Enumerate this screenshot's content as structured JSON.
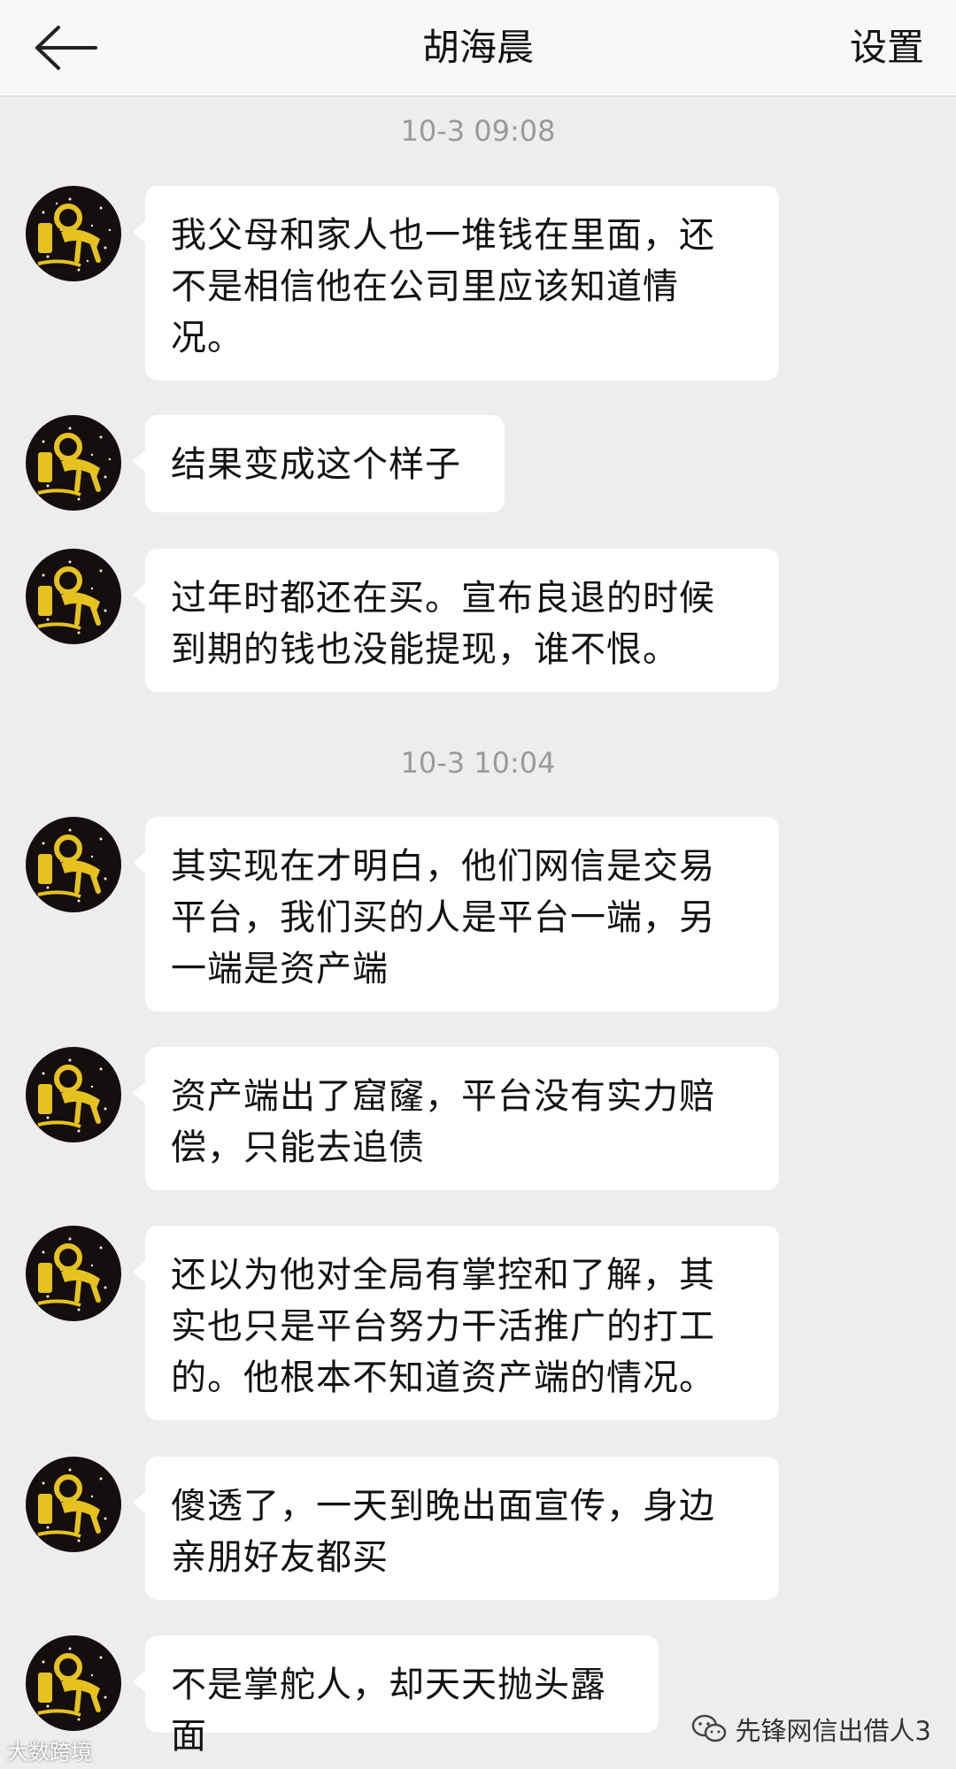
{
  "header": {
    "title": "胡海晨",
    "settings_label": "设置",
    "back_icon": "back-arrow-icon"
  },
  "timestamps": [
    "10-3 09:08",
    "10-3 10:04"
  ],
  "messages": [
    {
      "text": "我父母和家人也一堆钱在里面，还\n不是相信他在公司里应该知道情\n况。"
    },
    {
      "text": "结果变成这个样子"
    },
    {
      "text": "过年时都还在买。宣布良退的时候\n到期的钱也没能提现，谁不恨。"
    },
    {
      "text": "其实现在才明白，他们网信是交易\n平台，我们买的人是平台一端，另\n一端是资产端"
    },
    {
      "text": "资产端出了窟窿，平台没有实力赔\n偿，只能去追债"
    },
    {
      "text": "还以为他对全局有掌控和了解，其\n实也只是平台努力干活推广的打工\n的。他根本不知道资产端的情况。"
    },
    {
      "text": "傻透了，一天到晚出面宣传，身边\n亲朋好友都买"
    },
    {
      "text": "不是掌舵人，却天天抛头露面"
    }
  ],
  "watermarks": {
    "left": "大数跨境",
    "right": "先锋网信出借人3"
  },
  "colors": {
    "background": "#ededed",
    "header": "#f7f7f7",
    "bubble": "#ffffff",
    "avatar_bg": "#140e0e",
    "avatar_art": "#e6c21f",
    "timestamp": "#9a9a9a"
  }
}
